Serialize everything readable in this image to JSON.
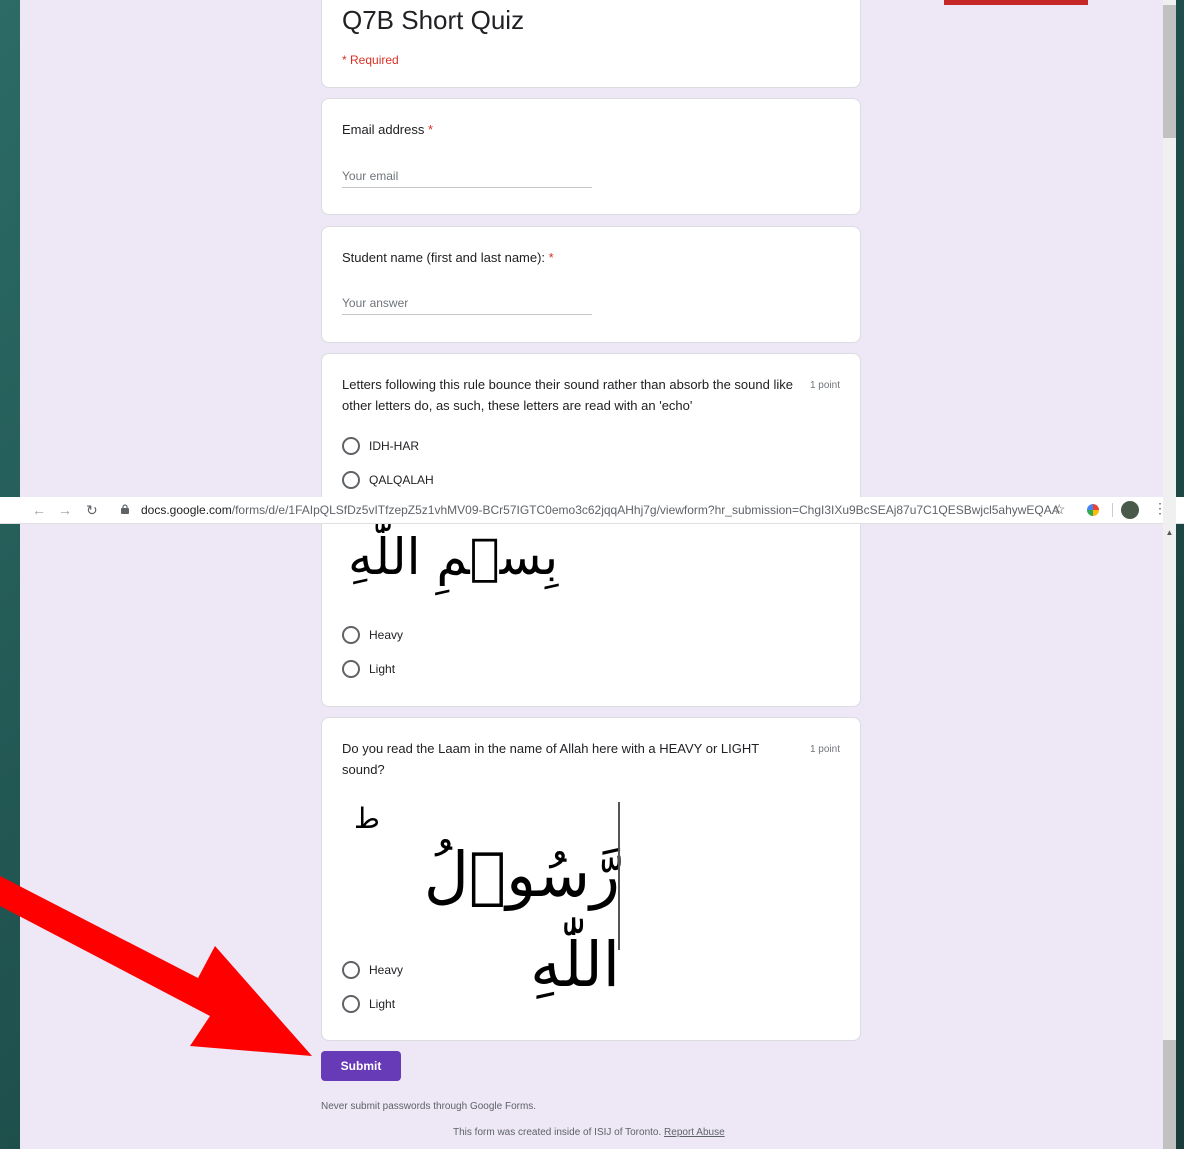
{
  "form": {
    "title": "Q7B Short Quiz",
    "required_note": "* Required",
    "email": {
      "label": "Email address",
      "placeholder": "Your email"
    },
    "student": {
      "label": "Student name (first and last name):",
      "placeholder": "Your answer"
    },
    "question_qalqalah": {
      "text": "Letters following this rule bounce their sound rather than absorb the sound like other letters do, as such, these letters are read with an 'echo'",
      "points": "1 point",
      "options": [
        "IDH-HAR",
        "QALQALAH"
      ]
    },
    "question_bismillah": {
      "calligraphy": "بِسۡمِ اللّٰهِ",
      "options": [
        "Heavy",
        "Light"
      ]
    },
    "question_rasool": {
      "text": "Do you read the Laam in the name of Allah here with a HEAVY or LIGHT sound?",
      "points": "1 point",
      "calligraphy": "رَّسُوۡلُ اللّٰهِ",
      "calligraphy_mark": "ط",
      "options": [
        "Heavy",
        "Light"
      ]
    },
    "required_star": "*",
    "submit_label": "Submit",
    "footer_note": "Never submit passwords through Google Forms.",
    "footer_created": "This form was created inside of ISIJ of Toronto.",
    "report_abuse": "Report Abuse"
  },
  "browser": {
    "url_host": "docs.google.com",
    "url_path": "/forms/d/e/1FAIpQLSfDz5vITfzepZ5z1vhMV09-BCr57IGTC0emo3c62jqqAHhj7g/viewform?hr_submission=ChgI3IXu9BcSEAj87u7C1QESBwjcl5ahywEQAA"
  },
  "colors": {
    "accent": "#673ab7",
    "form_background": "#ede7f6",
    "required": "#d93025",
    "arrow": "#ff0000"
  },
  "icons": [
    "back-arrow-icon",
    "forward-arrow-icon",
    "reload-icon",
    "lock-icon",
    "bookmark-star-icon",
    "extension-icon",
    "profile-avatar",
    "menu-dots-icon",
    "red-pointer-arrow"
  ]
}
